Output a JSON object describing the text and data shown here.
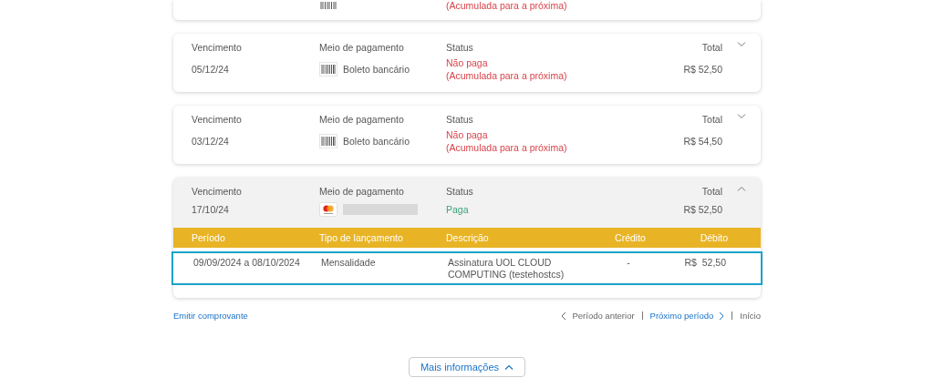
{
  "partial_invoice": {
    "payment_method": {
      "kind": "boleto"
    },
    "status_note": "(Acumulada para a próxima)",
    "paid": false
  },
  "invoices": [
    {
      "headers": [
        "Vencimento",
        "Meio de pagamento",
        "Status",
        "Total"
      ],
      "due_date": "05/12/24",
      "payment_method": {
        "kind": "boleto",
        "label": "Boleto bancário"
      },
      "status": "Não paga",
      "status_note": "(Acumulada para a próxima)",
      "paid": false,
      "total": "R$ 52,50",
      "expanded": false
    },
    {
      "headers": [
        "Vencimento",
        "Meio de pagamento",
        "Status",
        "Total"
      ],
      "due_date": "03/12/24",
      "payment_method": {
        "kind": "boleto",
        "label": "Boleto bancário"
      },
      "status": "Não paga",
      "status_note": "(Acumulada para a próxima)",
      "paid": false,
      "total": "R$ 54,50",
      "expanded": false
    },
    {
      "headers": [
        "Vencimento",
        "Meio de pagamento",
        "Status",
        "Total"
      ],
      "due_date": "17/10/24",
      "payment_method": {
        "kind": "card"
      },
      "status": "Paga",
      "paid": true,
      "total": "R$ 52,50",
      "expanded": true,
      "details": {
        "columns": [
          "Período",
          "Tipo de lançamento",
          "Descrição",
          "Crédito",
          "Débito"
        ],
        "rows": [
          {
            "period": "09/09/2024 a 08/10/2024",
            "type": "Mensalidade",
            "description": "Assinatura UOL CLOUD COMPUTING (testehostcs)",
            "credit": "-",
            "debit": "R$  52,50",
            "selected": true
          }
        ]
      }
    }
  ],
  "footer": {
    "receipt_link": "Emitir comprovante",
    "nav": [
      {
        "kind": "previous",
        "label": "Período anterior",
        "enabled": false
      },
      {
        "kind": "next",
        "label": "Próximo período",
        "enabled": true
      },
      {
        "kind": "first",
        "label": "Início",
        "enabled": false
      }
    ]
  },
  "more_button": {
    "label": "Mais informações"
  }
}
